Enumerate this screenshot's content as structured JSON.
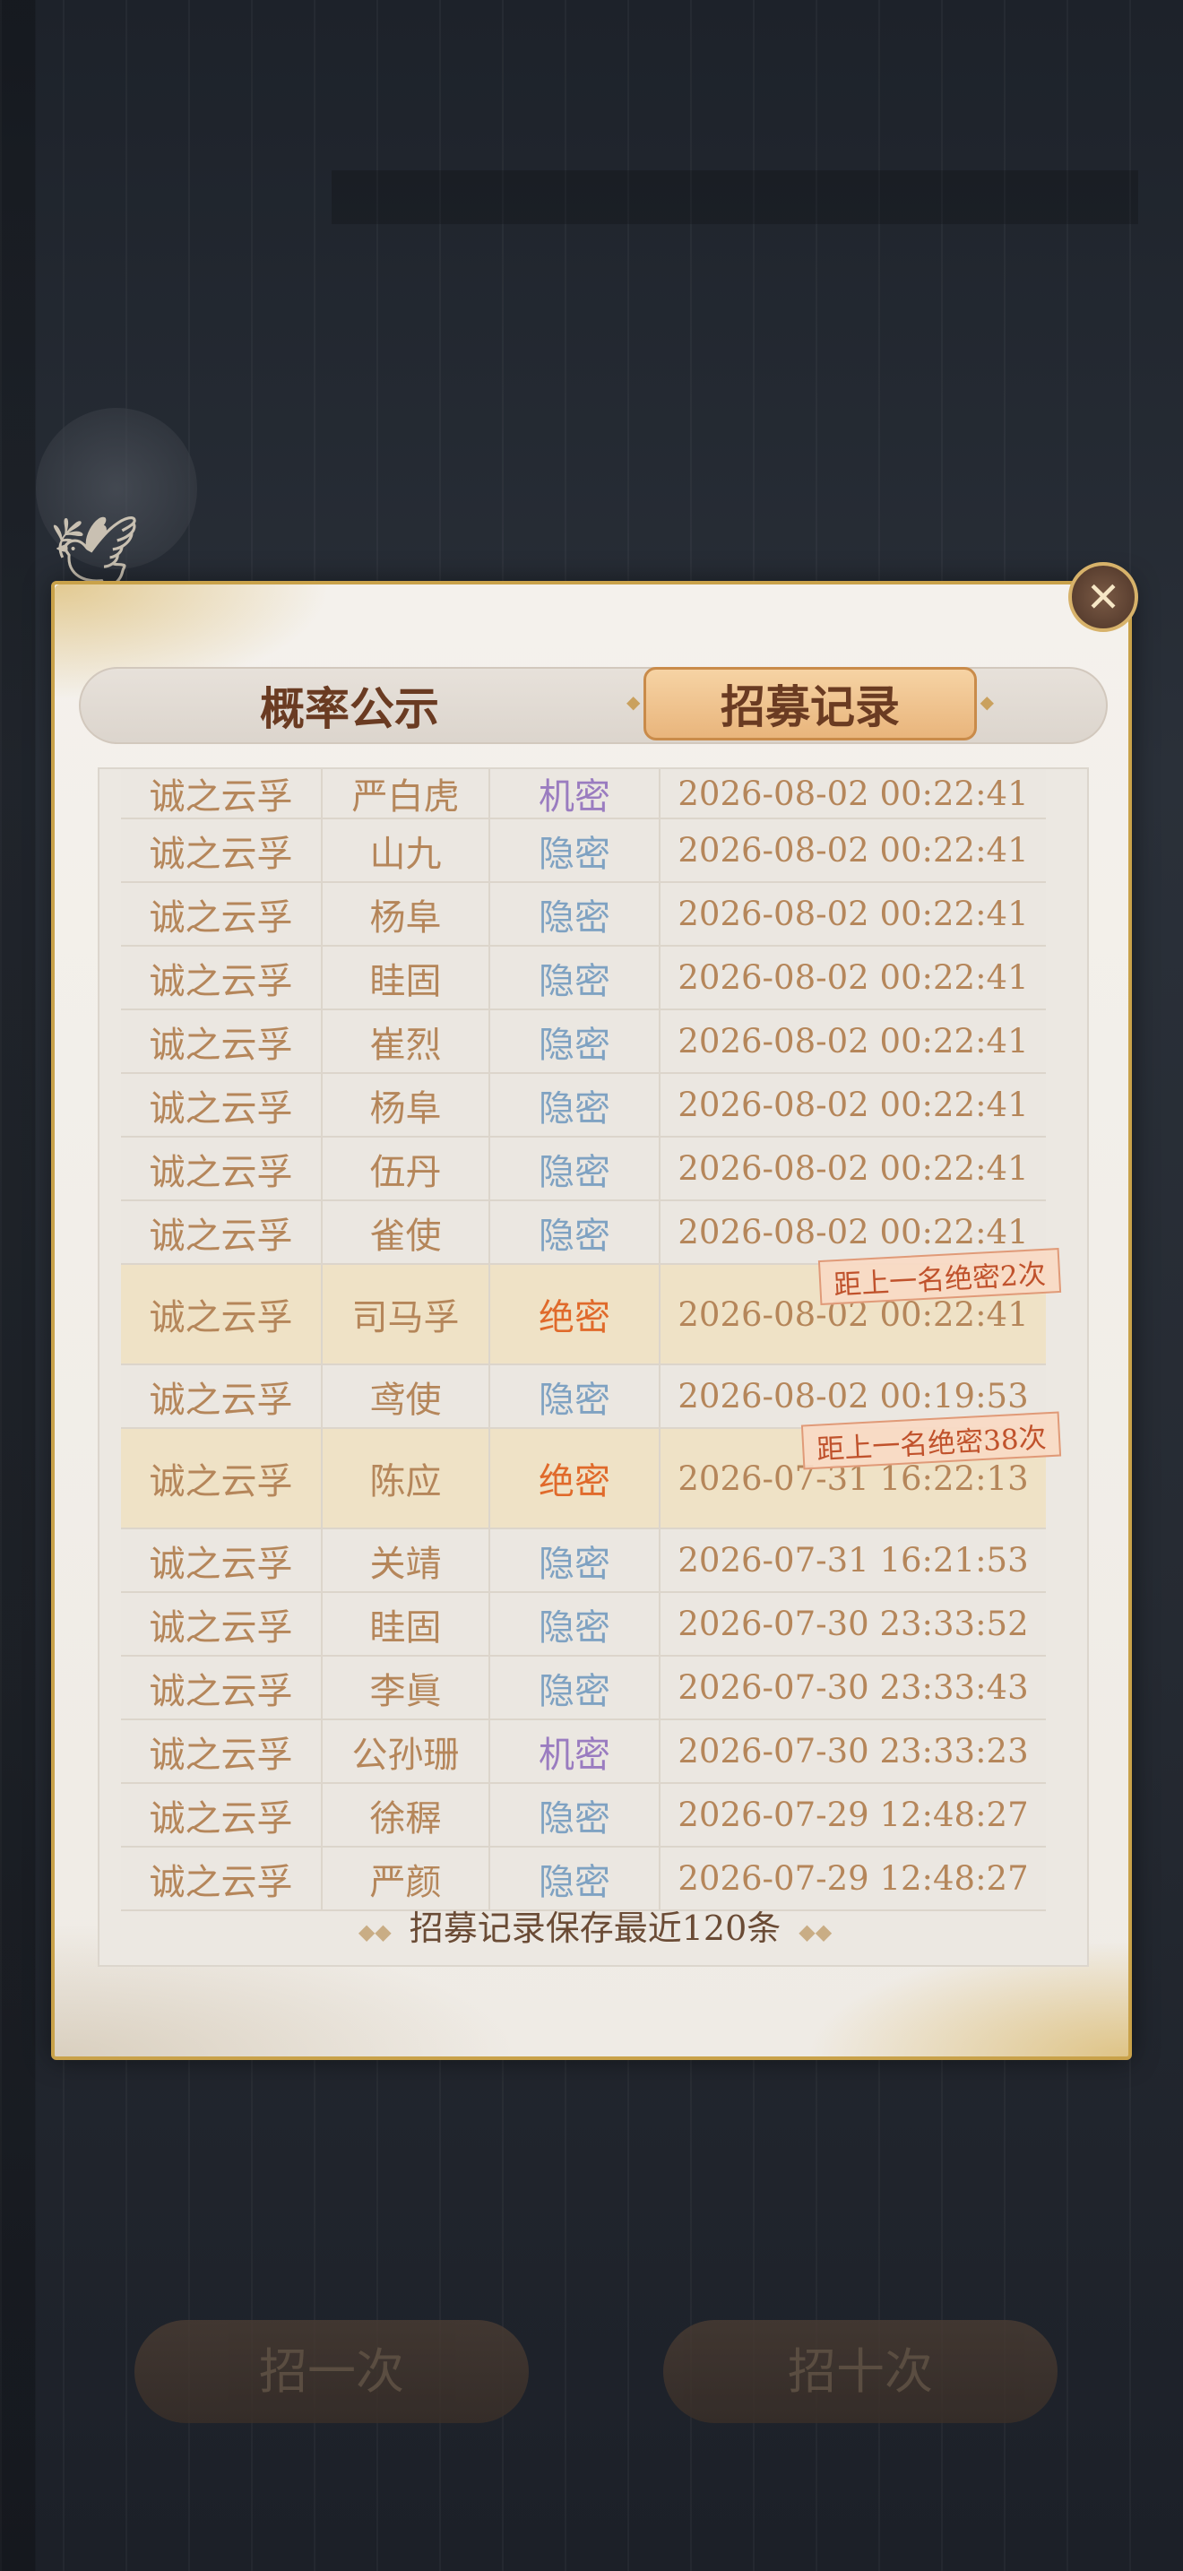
{
  "tabs": {
    "probability": "概率公示",
    "records": "招募记录"
  },
  "records": [
    {
      "pool": "诚之云孚",
      "name": "严白虎",
      "rarity": "机密",
      "time": "2026-08-02 00:22:41"
    },
    {
      "pool": "诚之云孚",
      "name": "山九",
      "rarity": "隐密",
      "time": "2026-08-02 00:22:41"
    },
    {
      "pool": "诚之云孚",
      "name": "杨阜",
      "rarity": "隐密",
      "time": "2026-08-02 00:22:41"
    },
    {
      "pool": "诚之云孚",
      "name": "眭固",
      "rarity": "隐密",
      "time": "2026-08-02 00:22:41"
    },
    {
      "pool": "诚之云孚",
      "name": "崔烈",
      "rarity": "隐密",
      "time": "2026-08-02 00:22:41"
    },
    {
      "pool": "诚之云孚",
      "name": "杨阜",
      "rarity": "隐密",
      "time": "2026-08-02 00:22:41"
    },
    {
      "pool": "诚之云孚",
      "name": "伍丹",
      "rarity": "隐密",
      "time": "2026-08-02 00:22:41"
    },
    {
      "pool": "诚之云孚",
      "name": "雀使",
      "rarity": "隐密",
      "time": "2026-08-02 00:22:41"
    },
    {
      "pool": "诚之云孚",
      "name": "司马孚",
      "rarity": "绝密",
      "time": "2026-08-02 00:22:41",
      "badge": "距上一名绝密2次"
    },
    {
      "pool": "诚之云孚",
      "name": "鸢使",
      "rarity": "隐密",
      "time": "2026-08-02 00:19:53"
    },
    {
      "pool": "诚之云孚",
      "name": "陈应",
      "rarity": "绝密",
      "time": "2026-07-31 16:22:13",
      "badge": "距上一名绝密38次"
    },
    {
      "pool": "诚之云孚",
      "name": "关靖",
      "rarity": "隐密",
      "time": "2026-07-31 16:21:53"
    },
    {
      "pool": "诚之云孚",
      "name": "眭固",
      "rarity": "隐密",
      "time": "2026-07-30 23:33:52"
    },
    {
      "pool": "诚之云孚",
      "name": "李眞",
      "rarity": "隐密",
      "time": "2026-07-30 23:33:43"
    },
    {
      "pool": "诚之云孚",
      "name": "公孙珊",
      "rarity": "机密",
      "time": "2026-07-30 23:33:23"
    },
    {
      "pool": "诚之云孚",
      "name": "徐稺",
      "rarity": "隐密",
      "time": "2026-07-29 12:48:27"
    },
    {
      "pool": "诚之云孚",
      "name": "严颜",
      "rarity": "隐密",
      "time": "2026-07-29 12:48:27"
    }
  ],
  "footer": {
    "note": "招募记录保存最近120条"
  },
  "icons": {
    "close": "close-icon",
    "bird": "bird-decoration-icon"
  },
  "colors": {
    "hidden_rarity": "#7fa2c2",
    "secret_rarity": "#9a7cc0",
    "top_rarity": "#e06a2b",
    "highlight_row": "#efe2c6",
    "gold_border": "#c9a24a"
  },
  "background_buttons": {
    "left": "招一次",
    "right": "招十次"
  }
}
